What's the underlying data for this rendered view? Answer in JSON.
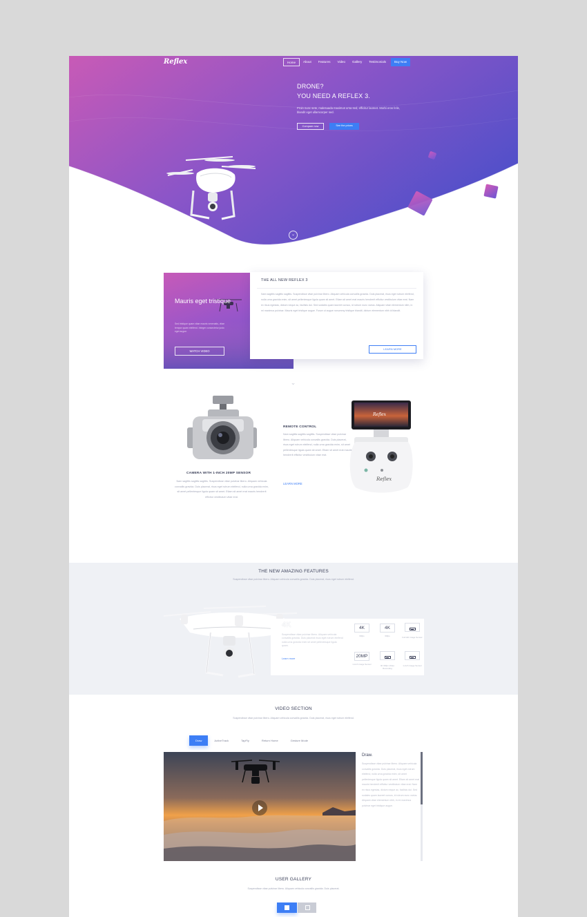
{
  "nav": {
    "logo": "Reflex",
    "items": [
      "Home",
      "About",
      "Features",
      "Video",
      "Gallery",
      "Testimonials"
    ],
    "buy": "Buy Now"
  },
  "hero": {
    "title_line1": "DRONE?",
    "title_line2": "YOU NEED A REFLEX 3.",
    "description": "Proin nunc sete, malesuada maximus urna sed, efficitur laoreet. Morbi eros felis, blandit eget ullamcorper sed.",
    "btn_compare": "Compare now",
    "btn_price": "See the prices",
    "colors": {
      "gradient_start": "#c85ab6",
      "gradient_end": "#5150c9",
      "accent": "#3d7ef5"
    }
  },
  "about": {
    "image_title": "Mauris eget tristique",
    "image_text": "Sed tristique quam vitae mauris venenatis, vitae tempor quam eleifend. Integer consectetur justo eget augue.",
    "watch_video": "WATCH VIDEO",
    "card_title": "THE ALL NEW REFLEX 3",
    "card_text": "Nam sagittis sagittis sagittis. Suspendisse vitae pulvinar libero. Aliquam vehicula convallis gravida. Duis placerat, risus eget rutrum eleifend, nulla urna gravida enim, sit amet pellentesque ligula quam sit amet. Etiam sit amet erat mauris hendrerit efficitur vestibulum vitae erat. Nam ex risus egestas, dictum neque ac, facilisis dui. Sed sodales quam laoreet cursus, id rutrum nunc varius. Aliquam vitae elementum nibh, in mi maximus pulvinar. Mauris eget tristique augue. Fusce ut augue nonummy tristique blandit, dictum elementum nibh id blandit.",
    "learn_more": "LEARN MORE"
  },
  "products": {
    "camera_title": "CAMERA WITH 1-INCH 20MP SENSOR",
    "camera_text": "Nam sagittis sagittis sagittis. Suspendisse vitae pulvinar libero. Aliquam vehicula convallis gravida. Duis placerat, risus eget rutrum eleifend, nulla urna gravida enim, sit amet pellentesque ligula quam sit amet. Etiam sit amet erat mauris hendrerit efficitur vestibulum vitae erat.",
    "remote_title": "REMOTE CONTROL",
    "remote_text": "Nam sagittis sagittis sagittis. Suspendisse vitae pulvinar libero. Aliquam vehicula convallis gravida. Duis placerat, risus eget rutrum eleifend, nulla urna gravida enim, sit amet pellentesque ligula quam sit amet. Etiam sit amet erat mauris hendrerit efficitur vestibulum vitae erat.",
    "remote_link": "LEARN MORE",
    "remote_screen_logo": "Reflex"
  },
  "features": {
    "title": "THE NEW AMAZING FEATURES",
    "subtitle": "Suspendisse vitae pulvinar libero. Aliquam vehicula convallis gravida. Duis placerat, risus eget rutrum eleifend.",
    "big_label": "4K",
    "big_desc": "Suspendisse vitae pulvinar libero. Aliquam vehicula convallis gravida. Duis placerat risus eget rutrum eleifend nulla urna gravida enim sit amet pellentesque ligula quam.",
    "big_link": "Learn more",
    "specs": [
      {
        "value": "4K",
        "label": "60fps"
      },
      {
        "value": "4K",
        "label": "60fps"
      },
      {
        "value": "",
        "label": "Full HD image Sensor",
        "icon": "battery-icon"
      },
      {
        "value": "20MP",
        "label": "1-inch image Sensor"
      },
      {
        "value": "",
        "label": "4K 60fps Video Recording",
        "icon": "battery-icon"
      },
      {
        "value": "",
        "label": "1-inch image Sensor",
        "icon": "battery-icon"
      }
    ]
  },
  "video": {
    "title": "VIDEO SECTION",
    "subtitle": "Suspendisse vitae pulvinar libero. Aliquam vehicula convallis gravida. Duis placerat, risus eget rutrum eleifend.",
    "tabs": [
      "Draw",
      "ActiveTrack",
      "TapFly",
      "Return Home",
      "Gesture Mode"
    ],
    "side_title": "Draw.",
    "side_text": "Suspendisse vitae pulvinar libero. Aliquam vehicula convallis gravida. Duis placerat, risus eget rutrum eleifend, nulla urna gravida enim, sit amet pellentesque ligula quam sit amet. Etiam sit amet erat mauris hendrerit efficitur vestibulum vitae erat. Nam ex risus egestas, dictum neque ac, facilisis dui. Sed sodales quam laoreet cursus, id rutrum nunc varius. Aliquam vitae elementum nibh, in mi maximus pulvinar eget tristique augue."
  },
  "gallery": {
    "title": "USER GALLERY",
    "subtitle": "Suspendisse vitae pulvinar libero. Aliquam vehicula convallis gravida. Duis placerat."
  }
}
